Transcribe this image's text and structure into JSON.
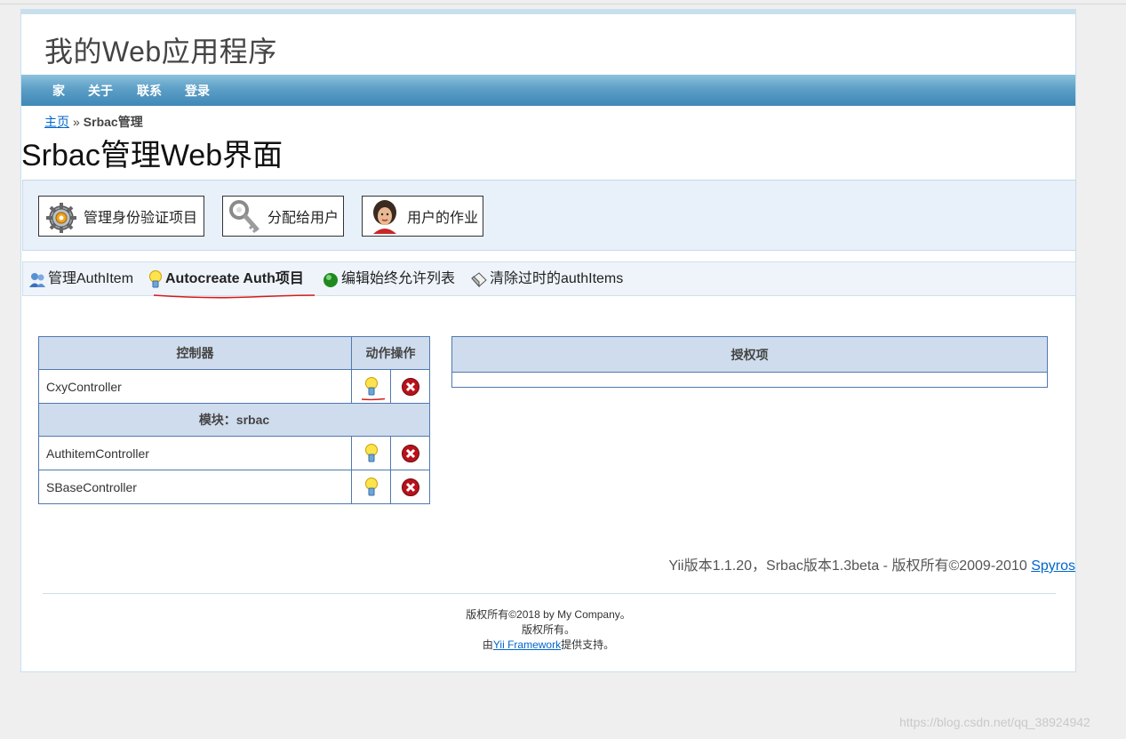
{
  "header": {
    "site_title": "我的Web应用程序"
  },
  "mainmenu": {
    "items": [
      "家",
      "关于",
      "联系",
      "登录"
    ]
  },
  "breadcrumb": {
    "home": "主页",
    "separator": "»",
    "current": "Srbac管理"
  },
  "page_title": "Srbac管理Web界面",
  "action_buttons": [
    {
      "label": "管理身份验证项目",
      "icon": "gears-icon"
    },
    {
      "label": "分配给用户",
      "icon": "keys-icon"
    },
    {
      "label": "用户的作业",
      "icon": "user-avatar-icon"
    }
  ],
  "subnav": {
    "items": [
      {
        "label": "管理AuthItem",
        "icon": "users-icon",
        "active": false
      },
      {
        "label": "Autocreate Auth项目",
        "icon": "lightbulb-icon",
        "active": true
      },
      {
        "label": "编辑始终允许列表",
        "icon": "green-dot-icon",
        "active": false
      },
      {
        "label": "清除过时的authItems",
        "icon": "eraser-icon",
        "active": false
      }
    ]
  },
  "controllers_table": {
    "headers": {
      "controller": "控制器",
      "actions": "动作操作"
    },
    "rows": [
      {
        "name": "CxyController"
      }
    ],
    "module_label": "模块：srbac",
    "module_rows": [
      {
        "name": "AuthitemController"
      },
      {
        "name": "SBaseController"
      }
    ]
  },
  "auth_table": {
    "header": "授权项"
  },
  "version": {
    "text": "Yii版本1.1.20，Srbac版本1.3beta - 版权所有©2009-2010 ",
    "link": "Spyros"
  },
  "footer": {
    "line1": "版权所有©2018 by My Company。",
    "line2": "版权所有。",
    "line3_prefix": "由",
    "line3_link": "Yii Framework",
    "line3_suffix": "提供支持。"
  },
  "watermark": "https://blog.csdn.net/qq_38924942",
  "colors": {
    "menu_bar": "#5d9fc6",
    "table_border": "#4f79b0",
    "table_header": "#cfdced",
    "link": "#0066cc"
  }
}
